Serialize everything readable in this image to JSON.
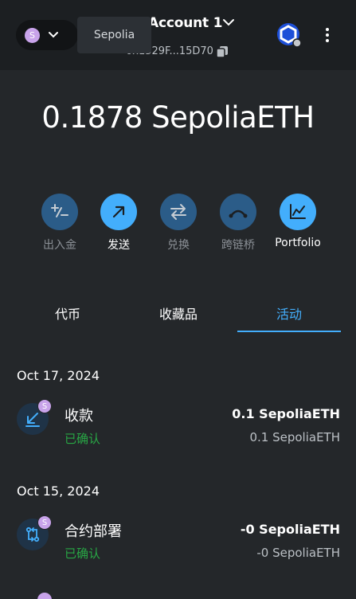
{
  "header": {
    "network_initial": "S",
    "network_tooltip": "Sepolia",
    "account_name": "Account 1",
    "account_address": "0x1529F...15D70"
  },
  "balance": "0.1878 SepoliaETH",
  "actions": [
    {
      "label": "出入金",
      "icon": "buy-sell-icon",
      "enabled": false
    },
    {
      "label": "发送",
      "icon": "send-arrow-icon",
      "enabled": true
    },
    {
      "label": "兑换",
      "icon": "swap-icon",
      "enabled": false
    },
    {
      "label": "跨链桥",
      "icon": "bridge-icon",
      "enabled": false
    },
    {
      "label": "Portfolio",
      "icon": "portfolio-chart-icon",
      "enabled": true
    }
  ],
  "tabs": [
    {
      "label": "代币",
      "active": false
    },
    {
      "label": "收藏品",
      "active": false
    },
    {
      "label": "活动",
      "active": true
    }
  ],
  "activity": [
    {
      "date": "Oct 17, 2024",
      "title": "收款",
      "status": "已确认",
      "amount": "0.1 SepoliaETH",
      "sub_amount": "0.1 SepoliaETH",
      "badge": "S",
      "icon": "receive-arrow-icon"
    },
    {
      "date": "Oct 15, 2024",
      "title": "合约部署",
      "status": "已确认",
      "amount": "-0 SepoliaETH",
      "sub_amount": "-0 SepoliaETH",
      "badge": "S",
      "icon": "contract-deploy-icon"
    }
  ],
  "colors": {
    "accent": "#43aefc",
    "confirmed": "#28a745",
    "network_badge": "#c8a3ea",
    "background": "#24272a"
  }
}
